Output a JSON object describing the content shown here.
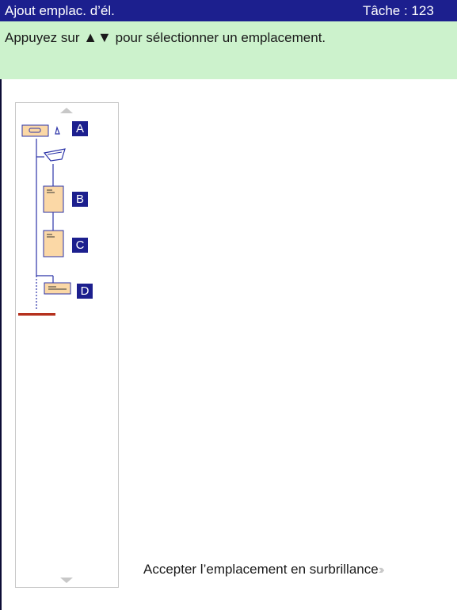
{
  "titlebar": {
    "title": "Ajout emplac. d’él.",
    "task": "Tâche : 123"
  },
  "instruction": {
    "prefix": "Appuyez sur",
    "arrows": "▲▼",
    "suffix": "pour sélectionner un emplacement."
  },
  "tree": {
    "nodes": [
      {
        "label": "A",
        "icon": "finisher-tray-icon"
      },
      {
        "label": "",
        "icon": "open-tray-icon"
      },
      {
        "label": "B",
        "icon": "document-icon"
      },
      {
        "label": "C",
        "icon": "document-icon"
      },
      {
        "label": "D",
        "icon": "landscape-document-icon"
      }
    ],
    "insertion_marker_color": "#b5311e"
  },
  "footer": {
    "accept_text": "Accepter l’emplacement en surbrillance",
    "accept_icon": "double-chevron-right-icon"
  },
  "colors": {
    "titlebar": "#1c1f8e",
    "instruction_bg": "#ccf2cc",
    "node_fill": "#fbd8a6",
    "tree_line": "#2b33a8"
  }
}
